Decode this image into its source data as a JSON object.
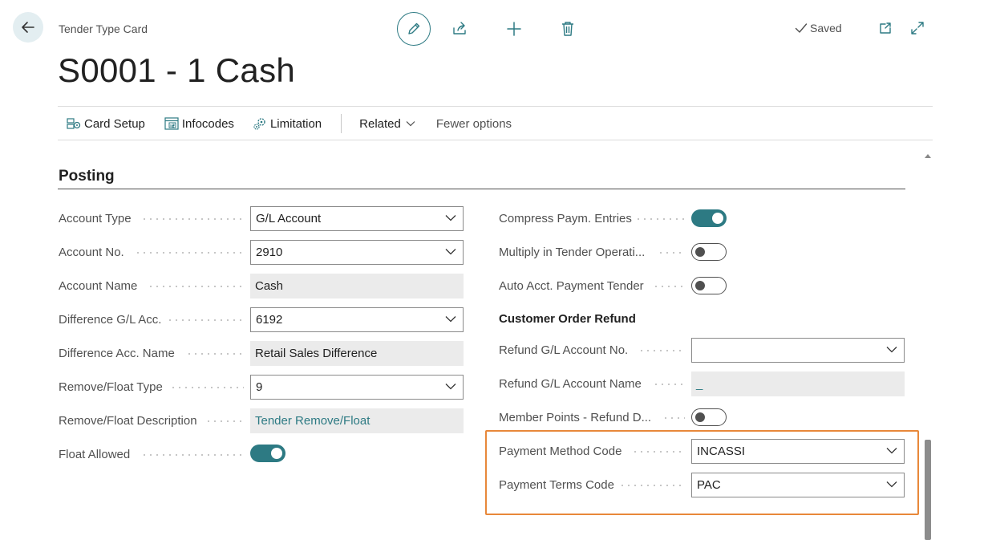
{
  "header": {
    "breadcrumb": "Tender Type Card",
    "title": "S0001 - 1 Cash",
    "status": "Saved"
  },
  "actionbar": {
    "items": [
      {
        "label": "Card Setup",
        "icon": "card-setup-icon"
      },
      {
        "label": "Infocodes",
        "icon": "infocodes-icon"
      },
      {
        "label": "Limitation",
        "icon": "limitation-icon"
      }
    ],
    "related": "Related",
    "fewer_options": "Fewer options"
  },
  "section": {
    "title": "Posting"
  },
  "left_fields": {
    "account_type": {
      "label": "Account Type",
      "value": "G/L Account"
    },
    "account_no": {
      "label": "Account No.",
      "value": "2910"
    },
    "account_name": {
      "label": "Account Name",
      "value": "Cash"
    },
    "difference_gl": {
      "label": "Difference G/L Acc.",
      "value": "6192"
    },
    "difference_name": {
      "label": "Difference Acc. Name",
      "value": "Retail Sales Difference"
    },
    "remove_float_type": {
      "label": "Remove/Float Type",
      "value": "9"
    },
    "remove_float_desc": {
      "label": "Remove/Float Description",
      "value": "Tender Remove/Float"
    },
    "float_allowed": {
      "label": "Float Allowed",
      "on": true
    }
  },
  "right_fields": {
    "compress": {
      "label": "Compress Paym. Entries",
      "on": true
    },
    "multiply": {
      "label": "Multiply in Tender Operati...",
      "on": false
    },
    "auto_acct": {
      "label": "Auto Acct. Payment Tender",
      "on": false
    },
    "customer_order_refund": "Customer Order Refund",
    "refund_gl_no": {
      "label": "Refund G/L Account No.",
      "value": ""
    },
    "refund_gl_name": {
      "label": "Refund G/L Account Name",
      "value": "_"
    },
    "member_points": {
      "label": "Member Points - Refund D...",
      "on": false
    },
    "payment_method": {
      "label": "Payment Method Code",
      "value": "INCASSI"
    },
    "payment_terms": {
      "label": "Payment Terms Code",
      "value": "PAC"
    }
  },
  "colors": {
    "accent": "#2d7a83",
    "highlight": "#e8883a"
  }
}
